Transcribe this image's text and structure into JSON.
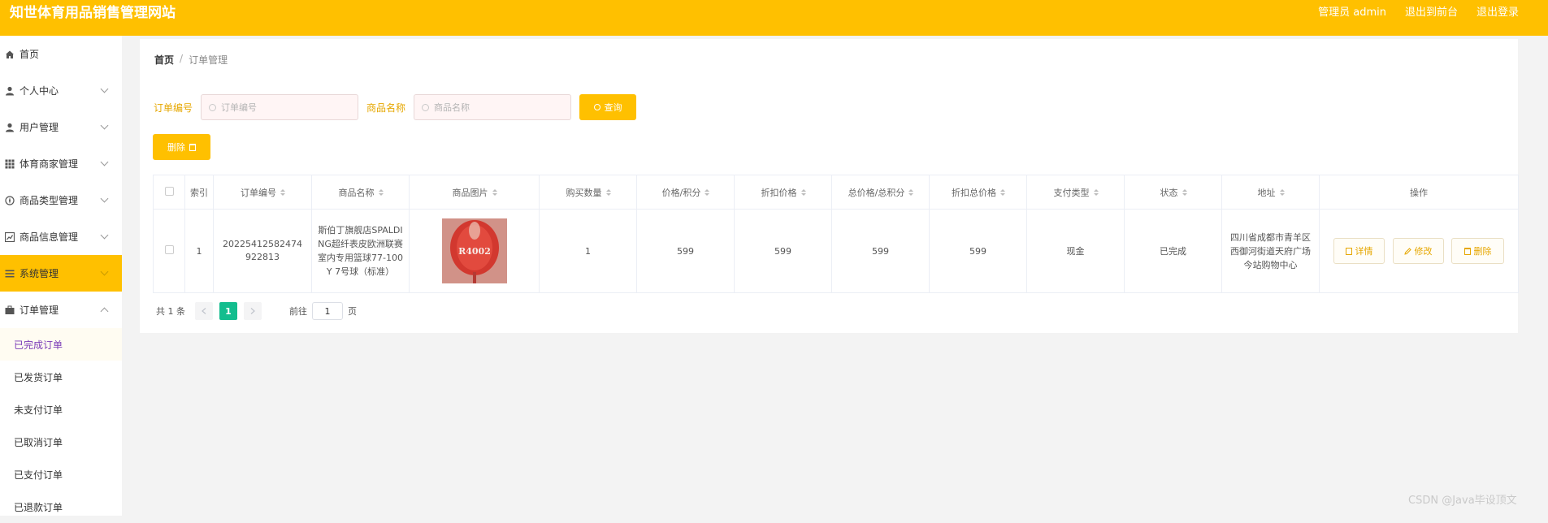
{
  "header": {
    "title": "知世体育用品销售管理网站",
    "admin_label": "管理员 admin",
    "back_frontend": "退出到前台",
    "logout": "退出登录"
  },
  "colors": {
    "accent": "#ffc000",
    "page_active": "#13bd8e"
  },
  "sidebar": {
    "items": [
      {
        "label": "首页",
        "icon": "home-icon"
      },
      {
        "label": "个人中心",
        "icon": "user-icon"
      },
      {
        "label": "用户管理",
        "icon": "user-icon"
      },
      {
        "label": "体育商家管理",
        "icon": "grid-icon"
      },
      {
        "label": "商品类型管理",
        "icon": "compass-icon"
      },
      {
        "label": "商品信息管理",
        "icon": "chart-icon"
      },
      {
        "label": "系统管理",
        "icon": "list-icon"
      },
      {
        "label": "订单管理",
        "icon": "briefcase-icon"
      }
    ],
    "sub_items": [
      "已完成订单",
      "已发货订单",
      "未支付订单",
      "已取消订单",
      "已支付订单",
      "已退款订单"
    ]
  },
  "breadcrumb": {
    "home": "首页",
    "sep": "/",
    "current": "订单管理"
  },
  "search": {
    "order_label": "订单编号",
    "order_placeholder": "订单编号",
    "product_label": "商品名称",
    "product_placeholder": "商品名称",
    "query_button": "查询"
  },
  "toolbar": {
    "delete_label": "删除"
  },
  "table": {
    "headers": [
      "索引",
      "订单编号",
      "商品名称",
      "商品图片",
      "购买数量",
      "价格/积分",
      "折扣价格",
      "总价格/总积分",
      "折扣总价格",
      "支付类型",
      "状态",
      "地址",
      "操作"
    ],
    "rows": [
      {
        "index": "1",
        "order_no": "20225412582474922813",
        "product_name": "斯伯丁旗舰店SPALDING超纤表皮欧洲联赛室内专用篮球77-100Y 7号球（标准）",
        "image_text": "R4002",
        "quantity": "1",
        "price": "599",
        "discount_price": "599",
        "total_price": "599",
        "discount_total": "599",
        "pay_type": "现金",
        "status": "已完成",
        "address": "四川省成都市青羊区西御河街道天府广场今站购物中心",
        "op_detail": "详情",
        "op_edit": "修改",
        "op_delete": "删除"
      }
    ]
  },
  "pagination": {
    "total_text": "共 1 条",
    "current_page": "1",
    "goto_prefix": "前往",
    "goto_value": "1",
    "goto_suffix": "页"
  },
  "watermark": "CSDN @Java毕设顶文"
}
